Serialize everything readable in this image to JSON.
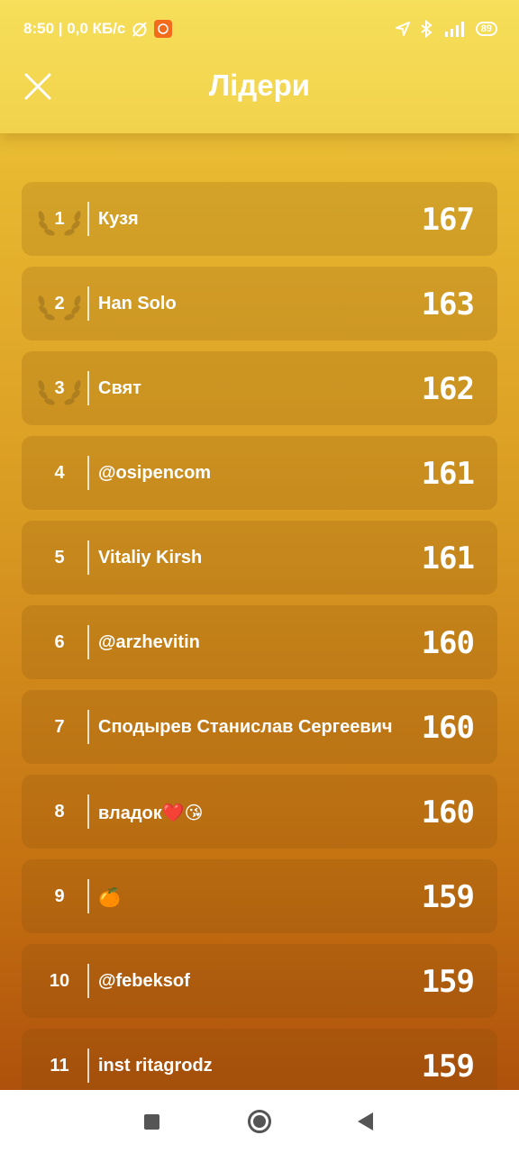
{
  "status_bar": {
    "time_network": "8:50 | 0,0 КБ/с",
    "battery": "89",
    "icons": [
      "alarm-off-icon",
      "app-notification-icon",
      "location-icon",
      "bluetooth-icon",
      "signal-icon",
      "battery-icon"
    ]
  },
  "header": {
    "title": "Лідери",
    "close_icon": "close-icon"
  },
  "leaders": [
    {
      "rank": "1",
      "name": "Кузя",
      "score": "167",
      "laurel": true
    },
    {
      "rank": "2",
      "name": "Han Solo",
      "score": "163",
      "laurel": true
    },
    {
      "rank": "3",
      "name": "Свят",
      "score": "162",
      "laurel": true
    },
    {
      "rank": "4",
      "name": "@osipencom",
      "score": "161",
      "laurel": false
    },
    {
      "rank": "5",
      "name": "Vitaliy Kirsh",
      "score": "161",
      "laurel": false
    },
    {
      "rank": "6",
      "name": "@arzhevitin",
      "score": "160",
      "laurel": false
    },
    {
      "rank": "7",
      "name": "Сподырев Станислав Сергеевич",
      "score": "160",
      "laurel": false
    },
    {
      "rank": "8",
      "name": "владок❤️😘",
      "score": "160",
      "laurel": false
    },
    {
      "rank": "9",
      "name": "🍊",
      "score": "159",
      "laurel": false
    },
    {
      "rank": "10",
      "name": "@febeksof",
      "score": "159",
      "laurel": false
    },
    {
      "rank": "11",
      "name": "inst ritagrodz",
      "score": "159",
      "laurel": false
    }
  ],
  "nav": {
    "recent_icon": "square-recents-icon",
    "home_icon": "circle-home-icon",
    "back_icon": "triangle-back-icon"
  }
}
